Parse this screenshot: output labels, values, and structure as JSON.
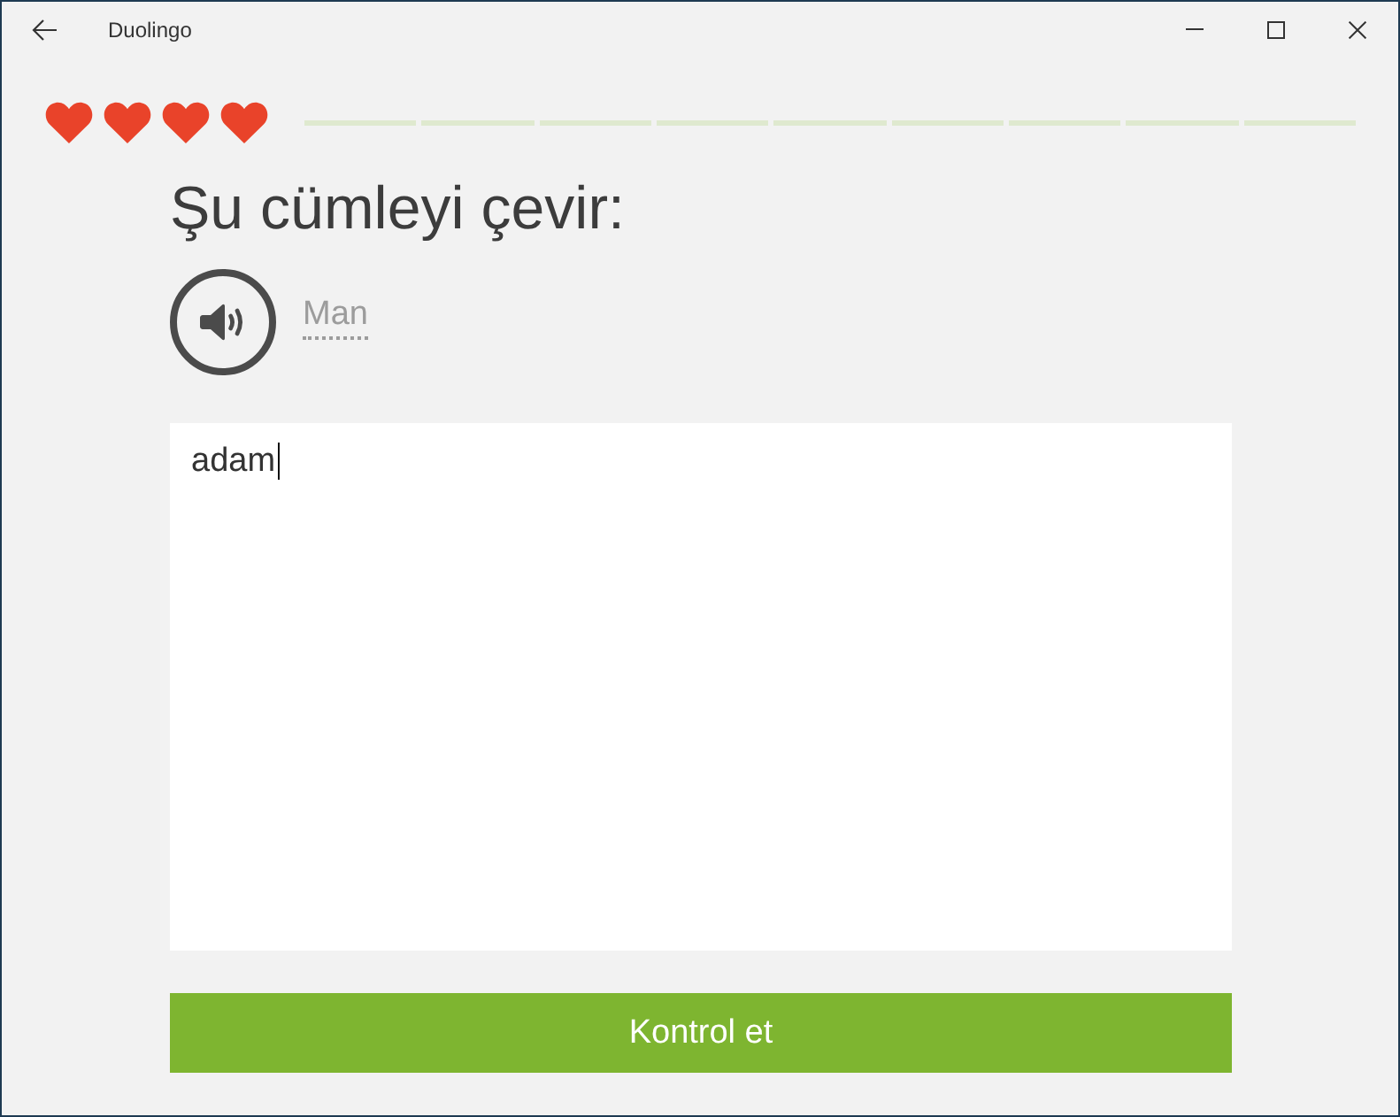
{
  "window": {
    "title": "Duolingo"
  },
  "hearts": [
    {
      "filled": true
    },
    {
      "filled": true
    },
    {
      "filled": true
    },
    {
      "filled": true
    }
  ],
  "progress": {
    "segments": [
      {
        "completed": false
      },
      {
        "completed": false
      },
      {
        "completed": false
      },
      {
        "completed": false
      },
      {
        "completed": false
      },
      {
        "completed": false
      },
      {
        "completed": false
      },
      {
        "completed": false
      },
      {
        "completed": false
      }
    ]
  },
  "prompt": {
    "instruction": "Şu cümleyi çevir:",
    "sentence": "Man"
  },
  "answer": {
    "value": "adam"
  },
  "check_button": {
    "label": "Kontrol et"
  }
}
